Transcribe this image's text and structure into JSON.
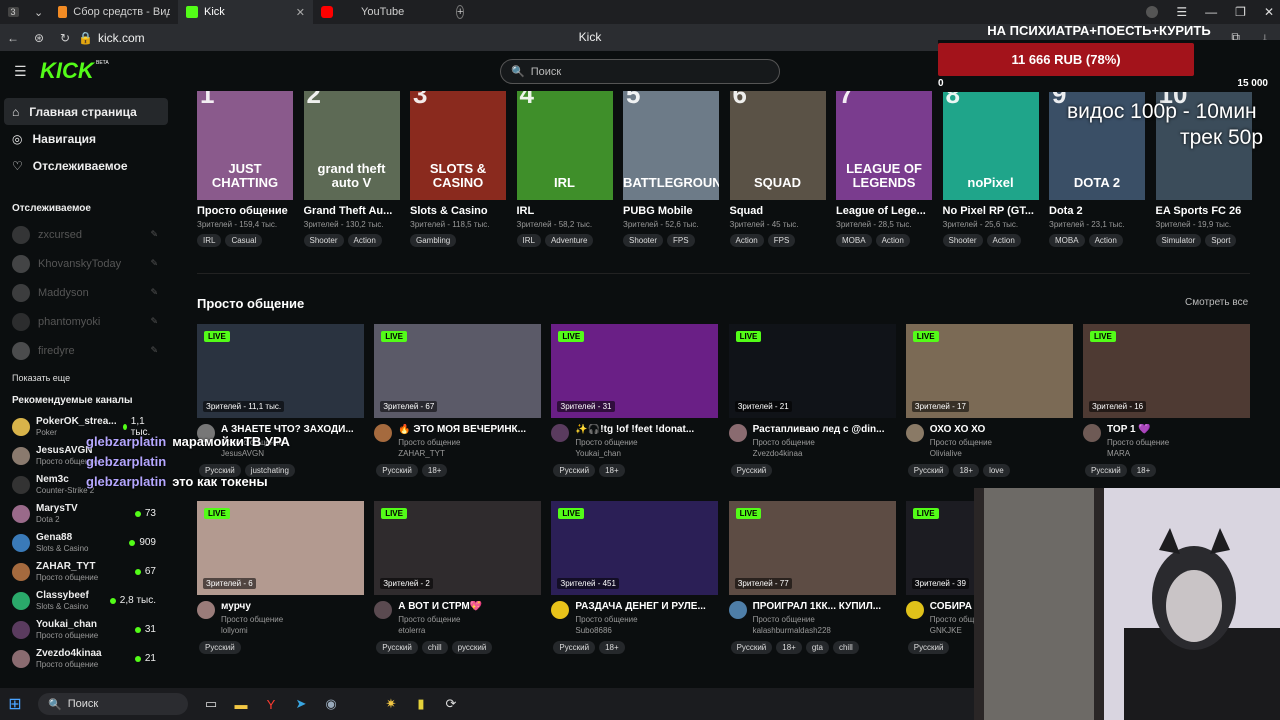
{
  "browser": {
    "tabs": [
      {
        "label": "Сбор средств - Виджеты",
        "color": "#f28b24"
      },
      {
        "label": "Kick",
        "color": "#53fc18"
      },
      {
        "label": "YouTube",
        "color": "#ff0000"
      }
    ],
    "tab_count": "3",
    "url": "kick.com",
    "page_title": "Kick"
  },
  "header": {
    "logo": "KICK",
    "logo_badge": "BETA",
    "search_placeholder": "Поиск"
  },
  "sidebar": {
    "nav": [
      {
        "label": "Главная страница"
      },
      {
        "label": "Навигация"
      },
      {
        "label": "Отслеживаемое"
      }
    ],
    "followed_title": "Отслеживаемое",
    "followed": [
      {
        "name": "zxcursed"
      },
      {
        "name": "KhovanskyToday"
      },
      {
        "name": "Maddyson"
      },
      {
        "name": "phantomyoki"
      },
      {
        "name": "firedyre"
      }
    ],
    "show_more": "Показать еще",
    "recommended_title": "Рекомендуемые каналы",
    "recommended": [
      {
        "name": "PokerOK_strea...",
        "cat": "Poker",
        "viewers": "1,1 тыс."
      },
      {
        "name": "JesusAVGN",
        "cat": "Просто общение",
        "viewers": ""
      },
      {
        "name": "Nem3c",
        "cat": "Counter-Strike 2",
        "viewers": ""
      },
      {
        "name": "MarysTV",
        "cat": "Dota 2",
        "viewers": "73"
      },
      {
        "name": "Gena88",
        "cat": "Slots & Casino",
        "viewers": "909"
      },
      {
        "name": "ZAHAR_TYT",
        "cat": "Просто общение",
        "viewers": "67"
      },
      {
        "name": "Classybeef",
        "cat": "Slots & Casino",
        "viewers": "2,8 тыс."
      },
      {
        "name": "Youkai_chan",
        "cat": "Просто общение",
        "viewers": "31"
      },
      {
        "name": "Zvezdo4kinaa",
        "cat": "Просто общение",
        "viewers": "21"
      }
    ]
  },
  "categories": [
    {
      "num": "1",
      "art": "JUST CHATTING",
      "name": "Просто общение",
      "viewers": "Зрителей - 159,4 тыс.",
      "tags": [
        "IRL",
        "Casual"
      ],
      "bg": "#8a5a8c"
    },
    {
      "num": "2",
      "art": "grand theft auto V",
      "name": "Grand Theft Au...",
      "viewers": "Зрителей - 130,2 тыс.",
      "tags": [
        "Shooter",
        "Action"
      ],
      "bg": "#5d6a55"
    },
    {
      "num": "3",
      "art": "SLOTS & CASINO",
      "name": "Slots & Casino",
      "viewers": "Зрителей - 118,5 тыс.",
      "tags": [
        "Gambling"
      ],
      "bg": "#8a2a1e"
    },
    {
      "num": "4",
      "art": "IRL",
      "name": "IRL",
      "viewers": "Зрителей - 58,2 тыс.",
      "tags": [
        "IRL",
        "Adventure"
      ],
      "bg": "#3f8f2a"
    },
    {
      "num": "5",
      "art": "BATTLEGROUNDS",
      "name": "PUBG Mobile",
      "viewers": "Зрителей - 52,6 тыс.",
      "tags": [
        "Shooter",
        "FPS"
      ],
      "bg": "#6d7b88"
    },
    {
      "num": "6",
      "art": "SQUAD",
      "name": "Squad",
      "viewers": "Зрителей - 45 тыс.",
      "tags": [
        "Action",
        "FPS"
      ],
      "bg": "#5a5246"
    },
    {
      "num": "7",
      "art": "LEAGUE OF LEGENDS",
      "name": "League of Lege...",
      "viewers": "Зрителей - 28,5 тыс.",
      "tags": [
        "MOBA",
        "Action"
      ],
      "bg": "#7a3c8e"
    },
    {
      "num": "8",
      "art": "noPixel",
      "name": "No Pixel RP (GT...",
      "viewers": "Зрителей - 25,6 тыс.",
      "tags": [
        "Shooter",
        "Action"
      ],
      "bg": "#1fa58a"
    },
    {
      "num": "9",
      "art": "DOTA 2",
      "name": "Dota 2",
      "viewers": "Зрителей - 23,1 тыс.",
      "tags": [
        "MOBA",
        "Action"
      ],
      "bg": "#3a4f66"
    },
    {
      "num": "10",
      "art": "",
      "name": "EA Sports FC 26",
      "viewers": "Зрителей - 19,9 тыс.",
      "tags": [
        "Simulator",
        "Sport"
      ],
      "bg": "#3b4c5a"
    }
  ],
  "section": {
    "title": "Просто общение",
    "see_all": "Смотреть все"
  },
  "streams": [
    {
      "title": "А ЗНАЕТЕ ЧТО? ЗАХОДИ...",
      "cat": "Просто общение",
      "ch": "JesusAVGN",
      "viewers": "Зрителей - 11,1 тыс.",
      "tags": [
        "Русский",
        "justchating"
      ],
      "bg": "#2a3340",
      "av": "#777"
    },
    {
      "title": "🔥 ЭТО МОЯ ВЕЧЕРИНК...",
      "cat": "Просто общение",
      "ch": "ZAHAR_TYT",
      "viewers": "Зрителей - 67",
      "tags": [
        "Русский",
        "18+"
      ],
      "bg": "#5b5a68",
      "av": "#a56a3e"
    },
    {
      "title": "✨🎧!tg !of !feet !donat...",
      "cat": "Просто общение",
      "ch": "Youkai_chan",
      "viewers": "Зрителей - 31",
      "tags": [
        "Русский",
        "18+"
      ],
      "bg": "#6a1f86",
      "av": "#5a3b5e"
    },
    {
      "title": "Растапливаю лед с @din...",
      "cat": "Просто общение",
      "ch": "Zvezdo4kinaa",
      "viewers": "Зрителей - 21",
      "tags": [
        "Русский"
      ],
      "bg": "#101318",
      "av": "#8a6b70"
    },
    {
      "title": "ОХО ХО ХО",
      "cat": "Просто общение",
      "ch": "Olivialive",
      "viewers": "Зрителей - 17",
      "tags": [
        "Русский",
        "18+",
        "love"
      ],
      "bg": "#7b6a55",
      "av": "#8a7a66"
    },
    {
      "title": "TOP 1 💜",
      "cat": "Просто общение",
      "ch": "MARA",
      "viewers": "Зрителей - 16",
      "tags": [
        "Русский",
        "18+"
      ],
      "bg": "#4e3a33",
      "av": "#6e5a55"
    },
    {
      "title": "мурчу",
      "cat": "Просто общение",
      "ch": "lollyomi",
      "viewers": "Зрителей - 6",
      "tags": [
        "Русский"
      ],
      "bg": "#b39a90",
      "av": "#9a7c7a"
    },
    {
      "title": "А ВОТ И СТРМ💖",
      "cat": "Просто общение",
      "ch": "etolerra",
      "viewers": "Зрителей - 2",
      "tags": [
        "Русский",
        "chill",
        "русский"
      ],
      "bg": "#2f2b2d",
      "av": "#5a4a50"
    },
    {
      "title": "РАЗДАЧА ДЕНЕГ И РУЛЕ...",
      "cat": "Просто общение",
      "ch": "Subo8686",
      "viewers": "Зрителей - 451",
      "tags": [
        "Русский",
        "18+"
      ],
      "bg": "#2b1f56",
      "av": "#e8c21a"
    },
    {
      "title": "ПРОИГРАЛ 1КК... КУПИЛ...",
      "cat": "Просто общение",
      "ch": "kalashburmaldash228",
      "viewers": "Зрителей - 77",
      "tags": [
        "Русский",
        "18+",
        "gta",
        "chill"
      ],
      "bg": "#5d4c44",
      "av": "#4e7ea8"
    },
    {
      "title": "СОБИРА",
      "cat": "Просто общение",
      "ch": "GNKJKE",
      "viewers": "Зрителей - 39",
      "tags": [
        "Русский"
      ],
      "bg": "#1c1c22",
      "av": "#e0c21a"
    }
  ],
  "live_label": "LIVE",
  "overlay": {
    "goal_title": "НА ПСИХИАТРА+ПОЕСТЬ+КУРИТЬ",
    "progress_text": "11 666 RUB (78%)",
    "progress_fraction": 0.78,
    "min": "0",
    "max": "15 000",
    "price_line1": "видос 100р - 10мин",
    "price_line2": "трек 50р"
  },
  "chat": [
    {
      "user": "glebzarplatin",
      "msg": "марамойкиТВ УРА"
    },
    {
      "user": "glebzarplatin",
      "msg": ""
    },
    {
      "user": "glebzarplatin",
      "msg": "это как токены"
    }
  ],
  "taskbar": {
    "search_label": "Поиск"
  },
  "colors": {
    "accent": "#53fc18",
    "background": "#0b0e0f",
    "donation_bar": "#a3131b"
  }
}
